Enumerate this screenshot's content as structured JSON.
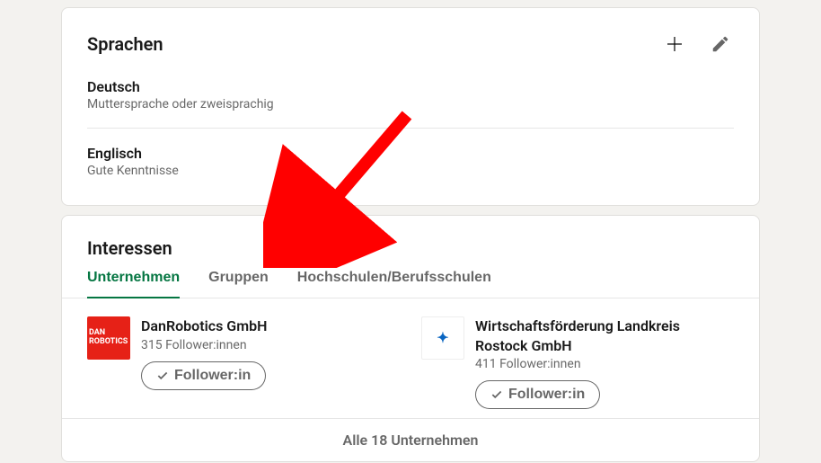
{
  "languages": {
    "title": "Sprachen",
    "items": [
      {
        "name": "Deutsch",
        "level": "Muttersprache oder zweisprachig"
      },
      {
        "name": "Englisch",
        "level": "Gute Kenntnisse"
      }
    ]
  },
  "interests": {
    "title": "Interessen",
    "tabs": [
      {
        "label": "Unternehmen",
        "active": true
      },
      {
        "label": "Gruppen",
        "active": false
      },
      {
        "label": "Hochschulen/Berufsschulen",
        "active": false
      }
    ],
    "companies": [
      {
        "name": "DanRobotics GmbH",
        "followers": "315 Follower:innen",
        "button": "Follower:in",
        "logo_text": "DAN\nROBOTICS",
        "logo_style": "red"
      },
      {
        "name": "Wirtschaftsförderung Landkreis Rostock GmbH",
        "followers": "411 Follower:innen",
        "button": "Follower:in",
        "logo_text": "✦",
        "logo_style": "white"
      }
    ],
    "footer": "Alle 18 Unternehmen"
  },
  "colors": {
    "accent_green": "#057642",
    "arrow": "#ff0000"
  }
}
